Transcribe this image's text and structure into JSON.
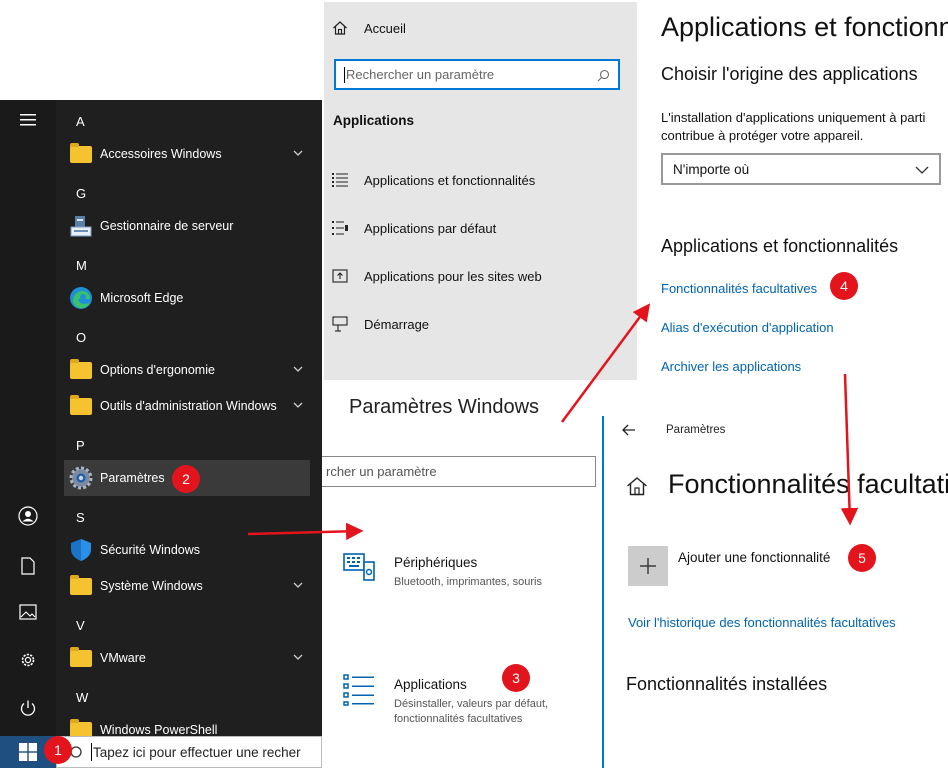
{
  "start_menu": {
    "letters": [
      "A",
      "G",
      "M",
      "O",
      "P",
      "S",
      "V",
      "W"
    ],
    "apps": {
      "accessoires": "Accessoires Windows",
      "gestionnaire": "Gestionnaire de serveur",
      "edge": "Microsoft Edge",
      "ergonomie": "Options d'ergonomie",
      "outils_admin": "Outils d'administration Windows",
      "parametres": "Paramètres",
      "securite": "Sécurité Windows",
      "systeme": "Système Windows",
      "vmware": "VMware",
      "powershell": "Windows PowerShell"
    }
  },
  "taskbar": {
    "search_text": "Tapez ici pour effectuer une recher"
  },
  "settings_nav": {
    "home": "Accueil",
    "search_placeholder": "Rechercher un paramètre",
    "section": "Applications",
    "items": [
      "Applications et fonctionnalités",
      "Applications par défaut",
      "Applications pour les sites web",
      "Démarrage"
    ]
  },
  "apps_panel": {
    "title": "Applications et fonctionn",
    "source_heading": "Choisir l'origine des applications",
    "source_desc_1": "L'installation d'applications uniquement à parti",
    "source_desc_2": "contribue à protéger votre appareil.",
    "source_select": "N'importe où",
    "apps_heading": "Applications et fonctionnalités",
    "link_optional": "Fonctionnalités facultatives",
    "link_alias": "Alias d'exécution d'application",
    "link_archive": "Archiver les applications"
  },
  "windows_settings": {
    "title": "Paramètres Windows",
    "search_placeholder": "rcher un paramètre",
    "devices_title": "Périphériques",
    "devices_desc": "Bluetooth, imprimantes, souris",
    "apps_title": "Applications",
    "apps_desc_1": "Désinstaller, valeurs par défaut,",
    "apps_desc_2": "fonctionnalités facultatives"
  },
  "features_panel": {
    "breadcrumb": "Paramètres",
    "title": "Fonctionnalités facultati",
    "add_feature": "Ajouter une fonctionnalité",
    "history_link": "Voir l'historique des fonctionnalités facultatives",
    "installed_heading": "Fonctionnalités installées"
  },
  "badges": [
    "1",
    "2",
    "3",
    "4",
    "5"
  ],
  "colors": {
    "start_bg": "#1f1f1f",
    "accent_link": "#0063b1",
    "badge_red": "#e3141c",
    "nav_bg": "#e6e6e6"
  }
}
